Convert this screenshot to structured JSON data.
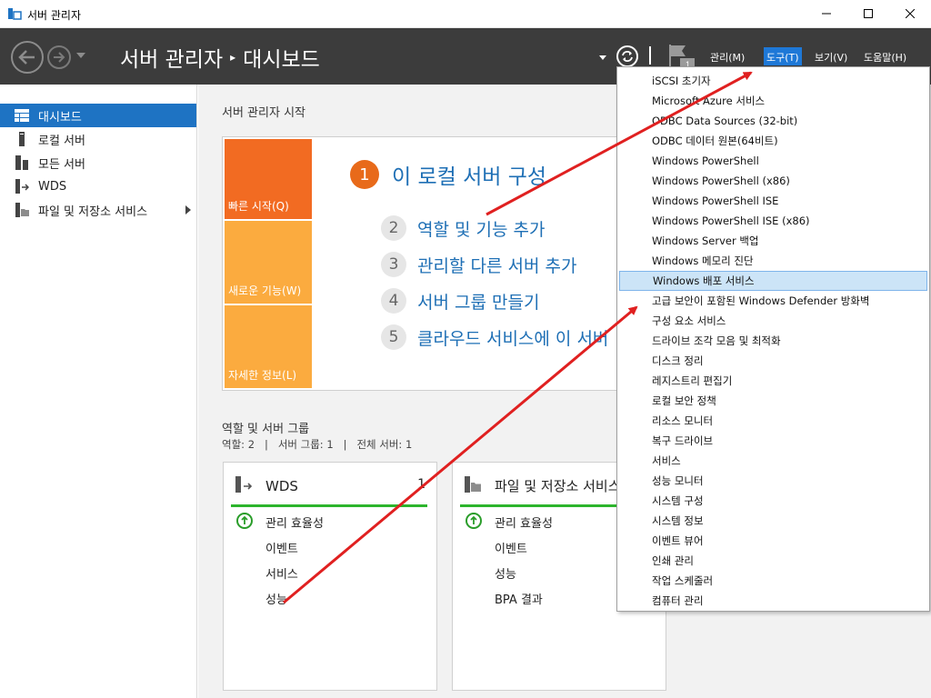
{
  "window": {
    "title": "서버 관리자"
  },
  "header": {
    "breadcrumb_root": "서버 관리자",
    "breadcrumb_sep": "▸",
    "breadcrumb_current": "대시보드",
    "flag_badge": "1",
    "menus": [
      "관리(M)",
      "도구(T)",
      "보기(V)",
      "도움말(H)"
    ]
  },
  "sidebar": {
    "items": [
      {
        "label": "대시보드",
        "icon": "dashboard-icon"
      },
      {
        "label": "로컬 서버",
        "icon": "local-server-icon"
      },
      {
        "label": "모든 서버",
        "icon": "all-servers-icon"
      },
      {
        "label": "WDS",
        "icon": "wds-icon"
      },
      {
        "label": "파일 및 저장소 서비스",
        "icon": "file-storage-icon"
      }
    ]
  },
  "welcome": {
    "title": "서버 관리자 시작",
    "tiles": [
      "빠른 시작(Q)",
      "새로운 기능(W)",
      "자세한 정보(L)"
    ],
    "steps": [
      {
        "num": "1",
        "label": "이 로컬 서버 구성"
      },
      {
        "num": "2",
        "label": "역할 및 기능 추가"
      },
      {
        "num": "3",
        "label": "관리할 다른 서버 추가"
      },
      {
        "num": "4",
        "label": "서버 그룹 만들기"
      },
      {
        "num": "5",
        "label": "클라우드 서비스에 이 서버"
      }
    ]
  },
  "roles": {
    "title": "역할 및 서버 그룹",
    "summary": "역할: 2   |   서버 그룹: 1   |   전체 서버: 1",
    "tiles": [
      {
        "name": "WDS",
        "count": "1",
        "rows": [
          "관리 효율성",
          "이벤트",
          "서비스",
          "성능"
        ]
      },
      {
        "name": "파일 및 저장소 서비스",
        "count": "",
        "rows": [
          "관리 효율성",
          "이벤트",
          "성능",
          "BPA 결과"
        ]
      }
    ]
  },
  "tools_menu": {
    "items": [
      "iSCSI 초기자",
      "Microsoft Azure 서비스",
      "ODBC Data Sources (32-bit)",
      "ODBC 데이터 원본(64비트)",
      "Windows PowerShell",
      "Windows PowerShell (x86)",
      "Windows PowerShell ISE",
      "Windows PowerShell ISE (x86)",
      "Windows Server 백업",
      "Windows 메모리 진단",
      "Windows 배포 서비스",
      "고급 보안이 포함된 Windows Defender 방화벽",
      "구성 요소 서비스",
      "드라이브 조각 모음 및 최적화",
      "디스크 정리",
      "레지스트리 편집기",
      "로컬 보안 정책",
      "리소스 모니터",
      "복구 드라이브",
      "서비스",
      "성능 모니터",
      "시스템 구성",
      "시스템 정보",
      "이벤트 뷰어",
      "인쇄 관리",
      "작업 스케줄러",
      "컴퓨터 관리"
    ],
    "highlighted_index": 10
  },
  "colors": {
    "header_bg": "#3c3c3c",
    "accent": "#1e73c3",
    "tile_orange": "#f26b22",
    "tile_amber": "#fbab3f",
    "health_green": "#2db52d",
    "annotation_red": "#e02020"
  }
}
